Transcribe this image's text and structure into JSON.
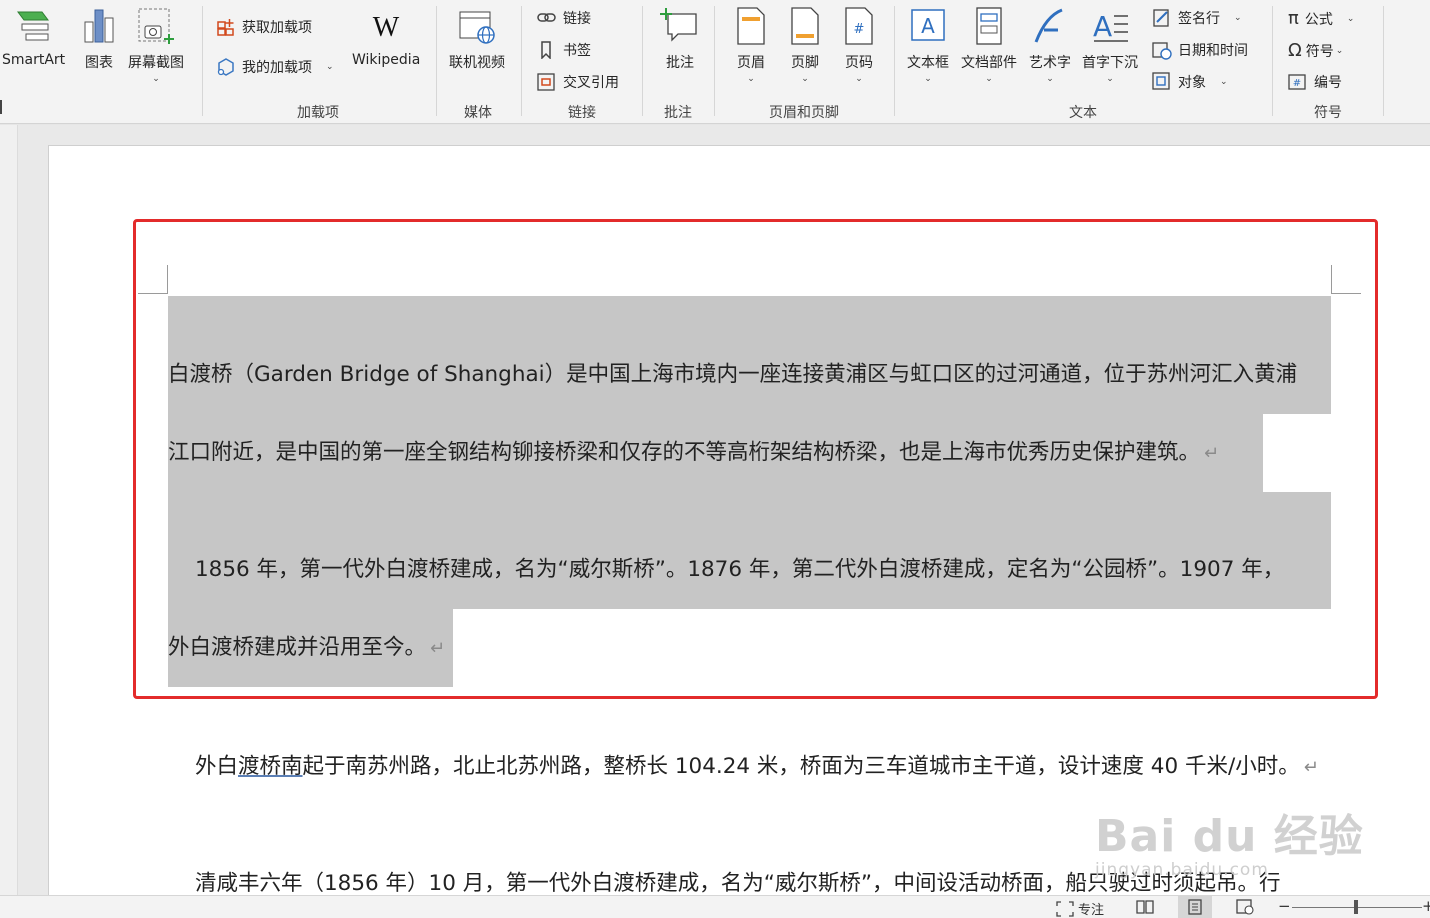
{
  "ribbon": {
    "buttons": {
      "smartart": "SmartArt",
      "chart": "图表",
      "screenshot": "屏幕截图",
      "get_addins": "获取加载项",
      "my_addins": "我的加载项",
      "wikipedia": "Wikipedia",
      "online_video": "联机视频",
      "link": "链接",
      "bookmark": "书签",
      "cross_ref": "交叉引用",
      "comment": "批注",
      "header": "页眉",
      "footer": "页脚",
      "page_number": "页码",
      "textbox": "文本框",
      "quick_parts": "文档部件",
      "wordart": "艺术字",
      "dropcap": "首字下沉",
      "signature_line": "签名行",
      "date_time": "日期和时间",
      "object": "对象",
      "equation": "公式",
      "symbol": "符号",
      "numbering": "编号"
    },
    "groups": {
      "addins": "加载项",
      "media": "媒体",
      "links": "链接",
      "comments": "批注",
      "header_footer": "页眉和页脚",
      "text": "文本",
      "symbols": "符号"
    }
  },
  "document": {
    "p1_line1": "白渡桥（Garden Bridge of Shanghai）是中国上海市境内一座连接黄浦区与虹口区的过河通道，位于苏州河汇入黄浦",
    "p1_line2": "江口附近，是中国的第一座全钢结构铆接桥梁和仅存的不等高桁架结构桥梁，也是上海市优秀历史保护建筑。",
    "p2_line1": "1856 年，第一代外白渡桥建成，名为“威尔斯桥”。1876 年，第二代外白渡桥建成，定名为“公园桥”。1907 年，",
    "p2_line2": "外白渡桥建成并沿用至今。",
    "p3_pre": "外白",
    "p3_underlined": "渡桥南",
    "p3_post": "起于南苏州路，北止北苏州路，整桥长 104.24 米，桥面为三车道城市主干道，设计速度 40 千米/小时。",
    "p4_line1": "清咸丰六年（1856 年）10 月，第一代外白渡桥建成，名为“威尔斯桥”，中间设活动桥面，船只驶过时须起吊。行",
    "para_mark": "↵"
  },
  "watermark": {
    "brand": "Bai du 经验",
    "url": "jingyan.baidu.com"
  },
  "statusbar": {
    "focus": "专注"
  }
}
